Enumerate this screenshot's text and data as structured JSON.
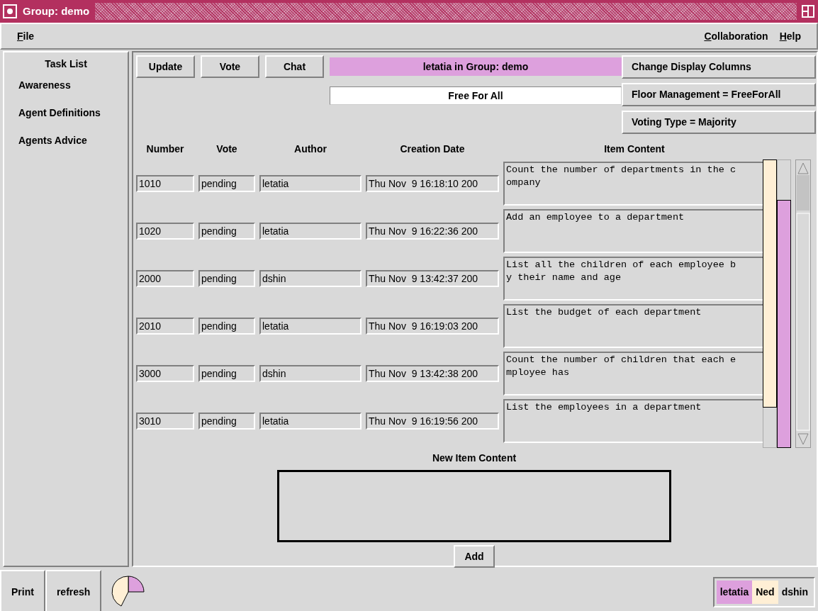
{
  "window": {
    "title": "Group: demo"
  },
  "menu": {
    "left": [
      {
        "label": "File",
        "mnemonic": true
      }
    ],
    "right": [
      {
        "label": "Collaboration",
        "mnemonic": true
      },
      {
        "label": "Help",
        "mnemonic": true
      }
    ]
  },
  "sidebar": {
    "title": "Task List",
    "items": [
      "Awareness",
      "Agent Definitions",
      "Agents Advice"
    ]
  },
  "toolbar": {
    "buttons": [
      "Update",
      "Vote",
      "Chat"
    ],
    "group_label": "letatia in Group: demo",
    "floor_mode": "Free For All"
  },
  "settings_buttons": [
    "Change Display Columns",
    "Floor Management = FreeForAll",
    "Voting Type = Majority"
  ],
  "table": {
    "columns": [
      "Number",
      "Vote",
      "Author",
      "Creation Date",
      "Item Content"
    ],
    "rows": [
      {
        "number": "1010",
        "vote": "pending",
        "author": "letatia",
        "created": "Thu Nov  9 16:18:10 200",
        "content": "Count the number of departments in the company"
      },
      {
        "number": "1020",
        "vote": "pending",
        "author": "letatia",
        "created": "Thu Nov  9 16:22:36 200",
        "content": "Add an employee to a department"
      },
      {
        "number": "2000",
        "vote": "pending",
        "author": "dshin",
        "created": "Thu Nov  9 13:42:37 200",
        "content": "List all the children of each employee by their name and age"
      },
      {
        "number": "2010",
        "vote": "pending",
        "author": "letatia",
        "created": "Thu Nov  9 16:19:03 200",
        "content": "List the budget of each department"
      },
      {
        "number": "3000",
        "vote": "pending",
        "author": "dshin",
        "created": "Thu Nov  9 13:42:38 200",
        "content": "Count the number of children that each employee has"
      },
      {
        "number": "3010",
        "vote": "pending",
        "author": "letatia",
        "created": "Thu Nov  9 16:19:56 200",
        "content": "List the employees in a department"
      }
    ]
  },
  "new_item": {
    "label": "New Item Content",
    "button": "Add"
  },
  "footer": {
    "buttons": [
      "Print",
      "refresh"
    ],
    "users": [
      {
        "name": "letatia",
        "color": "#dda0dd"
      },
      {
        "name": "Ned",
        "color": "#ffefd5"
      },
      {
        "name": "dshin",
        "color": "#d9d9d9"
      }
    ]
  }
}
